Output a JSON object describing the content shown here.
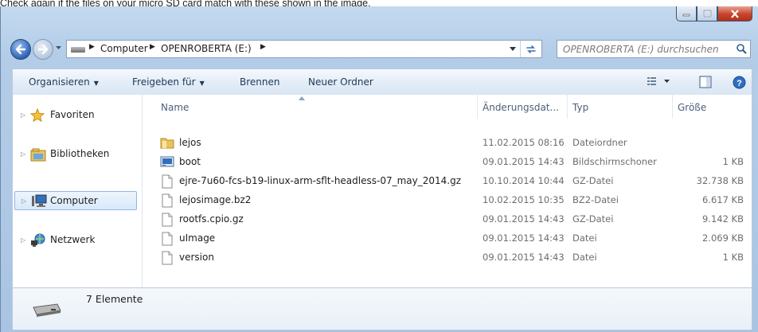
{
  "caption": "Check again if the files on your micro SD card match with these shown in the image.",
  "window": {
    "address": {
      "crumbs": [
        "Computer",
        "OPENROBERTA (E:)"
      ]
    },
    "search": {
      "placeholder": "OPENROBERTA (E:) durchsuchen"
    },
    "toolbar": {
      "organize": "Organisieren",
      "share": "Freigeben für",
      "burn": "Brennen",
      "new_folder": "Neuer Ordner"
    },
    "nav": {
      "items": [
        {
          "label": "Favoriten",
          "icon": "star-icon"
        },
        {
          "label": "Bibliotheken",
          "icon": "libraries-icon"
        },
        {
          "label": "Computer",
          "icon": "computer-icon",
          "selected": true
        },
        {
          "label": "Netzwerk",
          "icon": "network-icon"
        }
      ]
    },
    "columns": {
      "name": "Name",
      "date": "Änderungsdat...",
      "type": "Typ",
      "size": "Größe"
    },
    "files": [
      {
        "name": "lejos",
        "date": "11.02.2015 08:16",
        "type": "Dateiordner",
        "size": "",
        "icon": "folder-icon"
      },
      {
        "name": "boot",
        "date": "09.01.2015 14:43",
        "type": "Bildschirmschoner",
        "size": "1 KB",
        "icon": "screensaver-icon"
      },
      {
        "name": "ejre-7u60-fcs-b19-linux-arm-sflt-headless-07_may_2014.gz",
        "date": "10.10.2014 10:44",
        "type": "GZ-Datei",
        "size": "32.738 KB",
        "icon": "file-icon"
      },
      {
        "name": "lejosimage.bz2",
        "date": "10.02.2015 10:35",
        "type": "BZ2-Datei",
        "size": "6.617 KB",
        "icon": "file-icon"
      },
      {
        "name": "rootfs.cpio.gz",
        "date": "09.01.2015 14:43",
        "type": "GZ-Datei",
        "size": "9.142 KB",
        "icon": "file-icon"
      },
      {
        "name": "uImage",
        "date": "09.01.2015 14:43",
        "type": "Datei",
        "size": "2.069 KB",
        "icon": "file-icon"
      },
      {
        "name": "version",
        "date": "09.01.2015 14:43",
        "type": "Datei",
        "size": "1 KB",
        "icon": "file-icon"
      }
    ],
    "status": {
      "count": "7 Elemente"
    }
  }
}
